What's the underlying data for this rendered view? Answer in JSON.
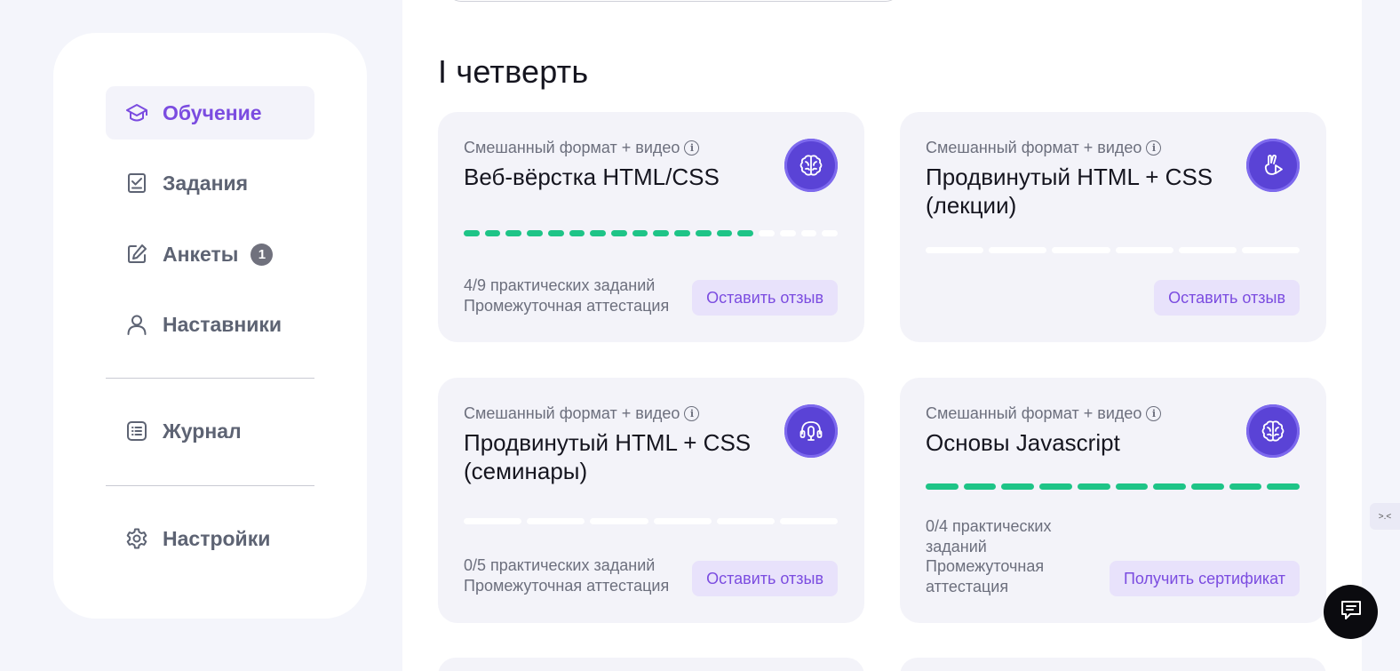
{
  "sidebar": {
    "items": [
      {
        "label": "Обучение",
        "icon": "graduation-cap-icon",
        "active": true
      },
      {
        "label": "Задания",
        "icon": "task-check-icon"
      },
      {
        "label": "Анкеты",
        "icon": "edit-form-icon",
        "badge": "1"
      },
      {
        "label": "Наставники",
        "icon": "user-icon"
      },
      {
        "label": "Журнал",
        "icon": "journal-icon"
      },
      {
        "label": "Настройки",
        "icon": "gear-icon"
      }
    ]
  },
  "main": {
    "section_title": "I четверть",
    "courses": [
      {
        "format": "Смешанный формат + видео",
        "title": "Веб-вёрстка HTML/CSS",
        "icon": "brain-icon",
        "progress_done": 14,
        "progress_total": 18,
        "meta_line1": "4/9 практических заданий",
        "meta_line2": "Промежуточная аттестация",
        "button": "Оставить отзыв"
      },
      {
        "format": "Смешанный формат + видео",
        "title": "Продвинутый HTML + CSS (лекции)",
        "icon": "hand-play-icon",
        "progress_done": 0,
        "progress_total": 6,
        "button": "Оставить отзыв"
      },
      {
        "format": "Смешанный формат + видео",
        "title": "Продвинутый HTML + CSS (семинары)",
        "icon": "headphones-mic-icon",
        "progress_done": 0,
        "progress_total": 6,
        "meta_line1": "0/5 практических заданий",
        "meta_line2": "Промежуточная аттестация",
        "button": "Оставить отзыв"
      },
      {
        "format": "Смешанный формат + видео",
        "title": "Основы Javascript",
        "icon": "brain-icon",
        "progress_done": 10,
        "progress_total": 10,
        "meta_line1": "0/4 практических заданий",
        "meta_line2": "Промежуточная аттестация",
        "button": "Получить сертификат"
      }
    ]
  },
  "colors": {
    "accent": "#7b4ce0",
    "progress": "#1ec487",
    "icon_bg": "#5a43d6"
  },
  "chat_button_icon": "chat-icon"
}
